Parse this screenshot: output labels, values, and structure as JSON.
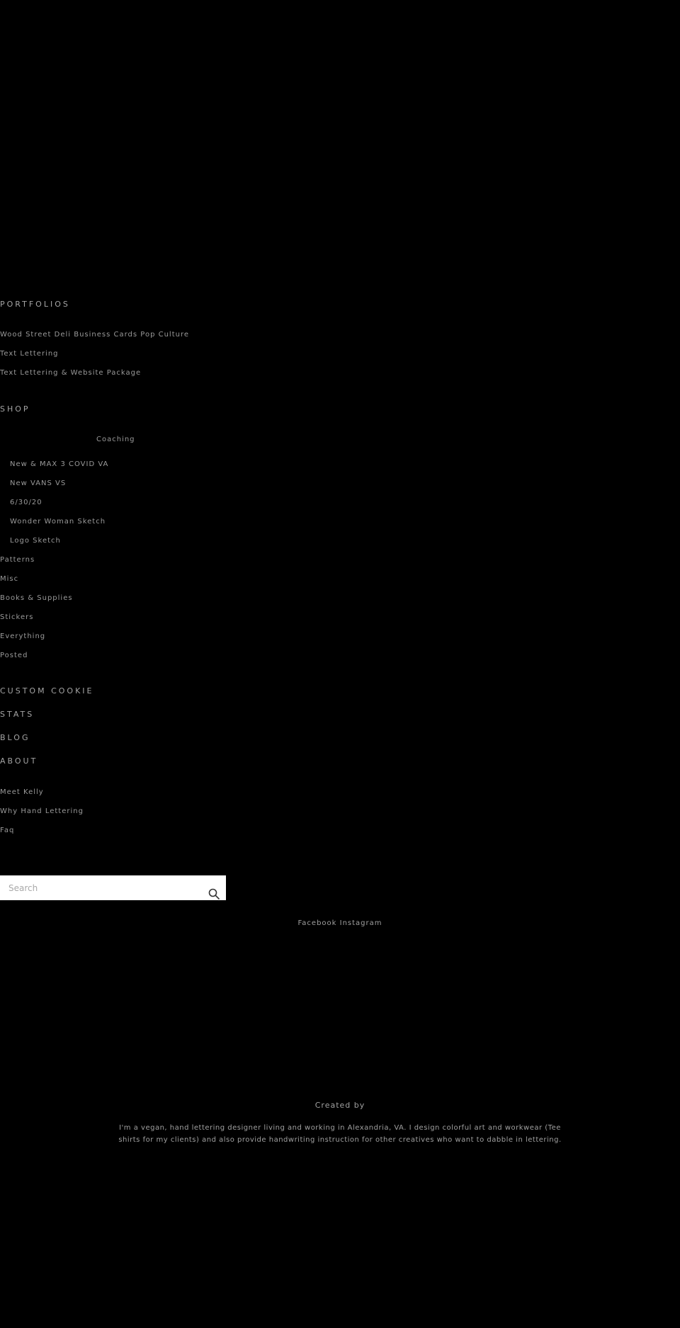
{
  "menu": {
    "sections": [
      {
        "title": "PORTFOLIOS",
        "items": [
          "Wood Street Deli Business Cards Pop Culture",
          "Text Lettering",
          "Text Lettering & Website Package"
        ]
      },
      {
        "title": "SHOP",
        "items": [
          "Coaching",
          "New & MAX 3 COVID VA",
          "New VANS VS",
          "6/30/20",
          "Wonder Woman Sketch",
          "Logo Sketch",
          "Patterns",
          "Misc",
          "Books & Supplies",
          "Stickers",
          "Everything",
          "Posted"
        ]
      },
      {
        "title": "CUSTOM COOKIE",
        "items": []
      },
      {
        "title": "STATS",
        "items": []
      },
      {
        "title": "BLOG",
        "items": []
      },
      {
        "title": "ABOUT",
        "items": [
          "Meet Kelly",
          "Why Hand Lettering",
          "Faq"
        ]
      }
    ]
  },
  "search": {
    "placeholder": "Search"
  },
  "widget": {
    "title": "Facebook Instagram"
  },
  "about": {
    "title": "Created by",
    "body": "I'm a vegan, hand lettering designer living and working in Alexandria, VA. I design colorful art and workwear (Tee shirts for my clients) and also provide handwriting instruction for other creatives who want to dabble in lettering."
  },
  "colors": {
    "background": "#000000",
    "text": "#9a9a9a",
    "search_bg": "#ffffff"
  }
}
